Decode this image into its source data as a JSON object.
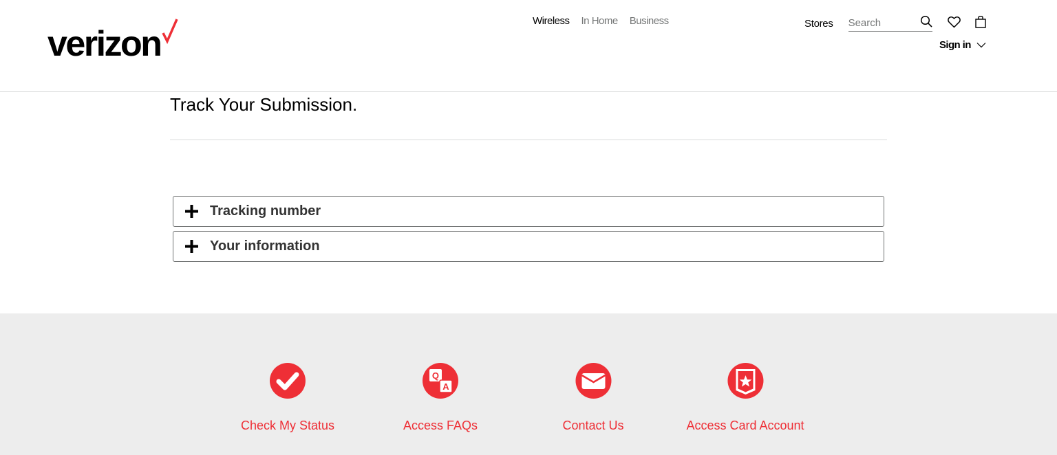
{
  "brand": {
    "logo_text": "verizon",
    "accent_color": "#ee2f36"
  },
  "header": {
    "nav_main": [
      {
        "label": "Wireless",
        "active": true
      },
      {
        "label": "In Home",
        "active": false
      },
      {
        "label": "Business",
        "active": false
      }
    ],
    "stores_label": "Stores",
    "search": {
      "placeholder": "Search",
      "value": ""
    },
    "icons": [
      "search-icon",
      "heart-icon",
      "shopping-bag-icon"
    ],
    "signin_label": "Sign in"
  },
  "main": {
    "title": "Track Your Submission.",
    "accordions": [
      {
        "label": "Tracking number",
        "expanded": false,
        "icon": "plus-icon"
      },
      {
        "label": "Your information",
        "expanded": false,
        "icon": "plus-icon"
      }
    ]
  },
  "footer": {
    "links": [
      {
        "label": "Check My Status",
        "icon": "checkmark-icon"
      },
      {
        "label": "Access FAQs",
        "icon": "qa-icon"
      },
      {
        "label": "Contact Us",
        "icon": "envelope-icon"
      },
      {
        "label": "Access Card Account",
        "icon": "card-star-icon"
      }
    ]
  }
}
